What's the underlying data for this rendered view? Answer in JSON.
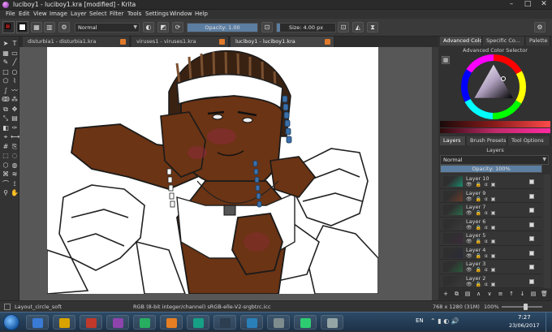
{
  "window": {
    "title": "luciboy1 - luciboy1.kra [modified] - Krita",
    "controls": [
      "–",
      "□",
      "✕"
    ]
  },
  "menu": [
    "File",
    "Edit",
    "View",
    "Image",
    "Layer",
    "Select",
    "Filter",
    "Tools",
    "Settings",
    "Window",
    "Help"
  ],
  "toolbar": {
    "blend_mode": "Normal",
    "opacity_label": "Opacity:  1.00",
    "opacity_value": 1.0,
    "size_label": "Size:  4.00 px",
    "size_fraction": 0.05,
    "fg_color": "#8a1a1a",
    "bg_color": "#ffffff"
  },
  "doc_tabs": [
    {
      "label": "disturbia1 - disturbia1.kra",
      "active": false
    },
    {
      "label": "viruses1 - viruses1.kra",
      "active": false
    },
    {
      "label": "luciboy1 - luciboy1.kra",
      "active": true
    }
  ],
  "toolbox": {
    "icons": [
      "pointer-icon",
      "text-icon",
      "grid-icon",
      "rect-select-icon",
      "brush-icon",
      "line-icon",
      "rectangle-icon",
      "ellipse-icon",
      "polygon-icon",
      "polyline-icon",
      "bezier-icon",
      "freehand-path-icon",
      "dyna-icon",
      "multibrush-icon",
      "crop-icon",
      "move-icon",
      "transform-icon",
      "gradient-icon",
      "fill-icon",
      "eyedropper-icon",
      "assistant-icon",
      "measure-icon",
      "grid-tool-icon",
      "reference-icon",
      "select-rect-icon",
      "select-ellipse-icon",
      "select-poly-icon",
      "select-outline-icon",
      "select-contiguous-icon",
      "select-similar-icon",
      "select-bezier-icon",
      "select-magnetic-icon",
      "zoom-icon",
      "pan-icon"
    ],
    "glyphs": [
      "➤",
      "T",
      "▦",
      "▭",
      "✎",
      "╱",
      "□",
      "○",
      "⬠",
      "⌇",
      "∫",
      "〰",
      "ↂ",
      "⁂",
      "⧉",
      "✥",
      "⤡",
      "▤",
      "◧",
      "✑",
      "⌖",
      "⟷",
      "#",
      "⎘",
      "⬚",
      "◌",
      "⬡",
      "◍",
      "⌘",
      "≋",
      "⌒",
      "⟟",
      "⚲",
      "✋"
    ]
  },
  "right_panel": {
    "top_tabs": [
      "Advanced Colo...",
      "Specific Co...",
      "Palette"
    ],
    "color_selector_title": "Advanced Color Selector",
    "layer_tabs": [
      "Layers",
      "Brush Presets",
      "Tool Options"
    ],
    "layers_title": "Layers",
    "layer_blend_mode": "Normal",
    "layer_opacity_label": "Opacity:  100%",
    "layer_opacity_value": 1.0,
    "layers": [
      {
        "name": "Layer 10",
        "thumb": "#1a8a6a"
      },
      {
        "name": "Layer 9",
        "thumb": "#6a3a2a"
      },
      {
        "name": "Layer 7",
        "thumb": "#2a6a4a"
      },
      {
        "name": "Layer 6",
        "thumb": "#3a3a3a"
      },
      {
        "name": "Layer 5",
        "thumb": "#3a2a3a"
      },
      {
        "name": "Layer 4",
        "thumb": "#2a2a3a"
      },
      {
        "name": "Layer 3",
        "thumb": "#2a5a3a"
      },
      {
        "name": "Layer 2",
        "thumb": "#3a3a3a"
      }
    ],
    "layer_state_icons": "👁 🔒 α ▣",
    "bottom_icons": [
      "+",
      "⧉",
      "▤",
      "∧",
      "∨",
      "≡",
      "↑",
      "↓",
      "▤",
      "🗑"
    ]
  },
  "status": {
    "brush": "Layout_circle_soft",
    "color_profile": "RGB (8-bit integer/channel)  sRGB-elle-V2-srgbtrc.icc",
    "dimensions": "768 x 1280 (31M)",
    "zoom": "100%",
    "zoom_fraction": 0.6
  },
  "taskbar": {
    "apps": [
      "#3a7bd5",
      "#d9a300",
      "#c0392b",
      "#8e44ad",
      "#27ae60",
      "#e67e22",
      "#16a085",
      "#2c3e50",
      "#2980b9",
      "#7f8c8d",
      "#2ecc71",
      "#95a5a6"
    ],
    "language": "EN",
    "time": "7:27",
    "date": "23/06/2017"
  },
  "colors": {
    "accent": "#5c7ea1",
    "skin": "#6b3414",
    "hair_bead": "#3b6fa8",
    "blush": "#8e2a3a"
  }
}
